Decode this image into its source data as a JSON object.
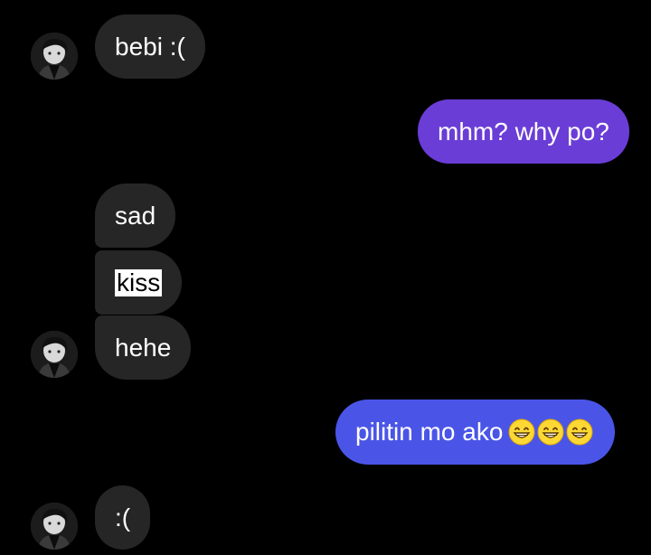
{
  "theme": {
    "background": "#000000",
    "incoming_bubble": "#262626",
    "outgoing_bubble_top": "#6a3dd6",
    "outgoing_bubble_bottom": "#4a55e8",
    "text_color": "#ffffff"
  },
  "messages": [
    {
      "id": "m1",
      "sender": "contact",
      "text": "bebi :(",
      "show_avatar": true
    },
    {
      "id": "m2",
      "sender": "me",
      "text": "mhm? why po?"
    },
    {
      "id": "m3",
      "sender": "contact",
      "text": "sad",
      "show_avatar": false
    },
    {
      "id": "m4",
      "sender": "contact",
      "text": "kiss",
      "highlighted": true,
      "show_avatar": false
    },
    {
      "id": "m5",
      "sender": "contact",
      "text": "hehe",
      "show_avatar": true
    },
    {
      "id": "m6",
      "sender": "me",
      "text": "pilitin mo ako",
      "emojis": [
        "grinning-face-with-smiling-eyes",
        "grinning-face-with-smiling-eyes",
        "grinning-face-with-smiling-eyes"
      ]
    },
    {
      "id": "m7",
      "sender": "contact",
      "text": ":(",
      "show_avatar": true
    }
  ]
}
